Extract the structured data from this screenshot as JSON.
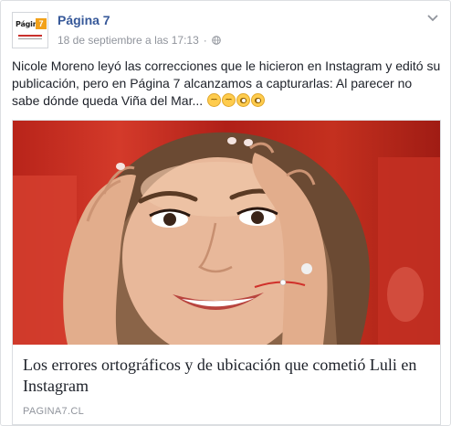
{
  "post": {
    "page_name": "Página 7",
    "timestamp": "18 de septiembre a las 17:13",
    "separator": "·",
    "privacy_icon": "globe-icon",
    "menu_icon": "chevron-down-icon",
    "avatar": {
      "logo_text": "Página",
      "logo_badge": "7"
    },
    "text": "Nicole Moreno leyó las correcciones que le hicieron en Instagram y editó su publicación, pero en Página 7 alcanzamos a capturarlas: Al parecer no sabe dónde queda Viña del Mar...",
    "emojis": [
      "pensive-emoji",
      "pensive-emoji",
      "flushed-emoji",
      "flushed-emoji"
    ]
  },
  "link_card": {
    "image_description_icon": "photo-woman-hands-on-head",
    "title": "Los errores ortográficos y de ubicación que cometió Luli en Instagram",
    "domain": "PAGINA7.CL"
  },
  "colors": {
    "link_blue": "#365899",
    "meta_gray": "#90949c",
    "text": "#1d2129",
    "border": "#dddfe2",
    "photo_background_red": "#c4301f"
  }
}
